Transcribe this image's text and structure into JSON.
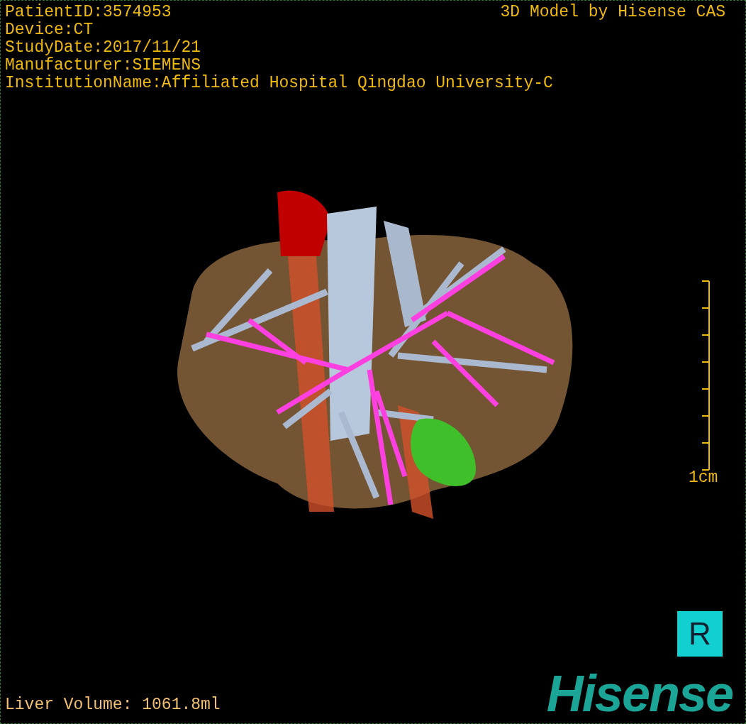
{
  "viewer": {
    "info_lines": [
      "PatientID:3574953",
      "Device:CT",
      "StudyDate:2017/11/21",
      "Manufacturer:SIEMENS",
      "InstitutionName:Affiliated Hospital Qingdao University-C"
    ],
    "model_credit": "3D Model by Hisense CAS",
    "scale_bar": {
      "label": "1cm"
    },
    "orientation_marker": "R",
    "volume": "Liver Volume: 1061.8ml",
    "logo": "Hisense"
  }
}
